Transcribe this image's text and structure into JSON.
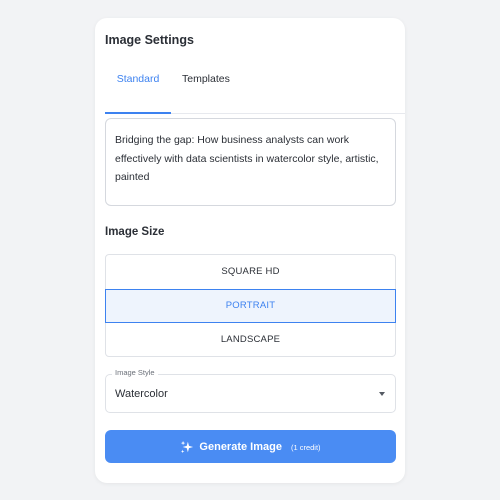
{
  "panel": {
    "title": "Image Settings"
  },
  "tabs": [
    {
      "label": "Standard",
      "active": true
    },
    {
      "label": "Templates",
      "active": false
    }
  ],
  "prompt": {
    "value": "Bridging the gap: How business analysts can work effectively with data scientists in watercolor style, artistic, painted"
  },
  "image_size": {
    "label": "Image Size",
    "options": [
      {
        "label": "SQUARE HD",
        "selected": false
      },
      {
        "label": "PORTRAIT",
        "selected": true
      },
      {
        "label": "LANDSCAPE",
        "selected": false
      }
    ]
  },
  "image_style": {
    "legend": "Image Style",
    "value": "Watercolor"
  },
  "generate": {
    "label": "Generate Image",
    "credit": "(1 credit)",
    "icon": "sparkle-icon"
  },
  "colors": {
    "accent": "#3d82f0",
    "button": "#4a8cf3",
    "selected_bg": "#eef4fd"
  }
}
